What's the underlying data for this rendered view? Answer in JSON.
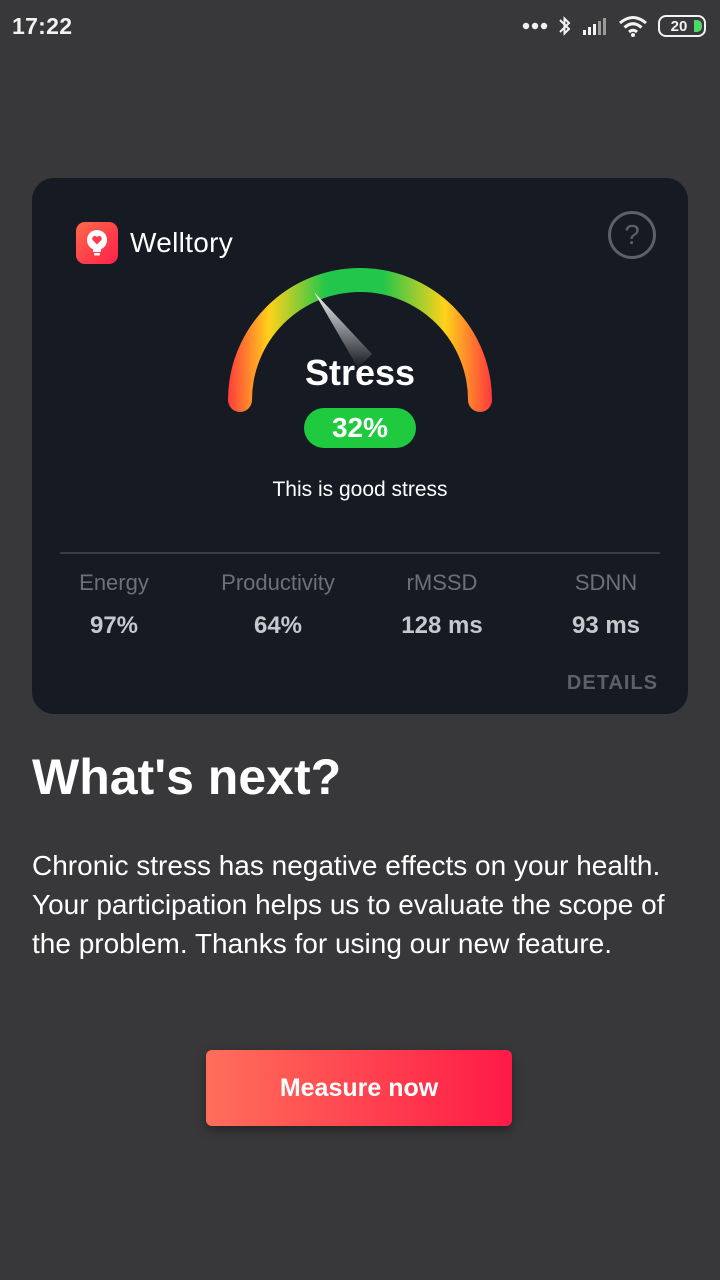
{
  "status_bar": {
    "time": "17:22",
    "battery": "20",
    "icons": [
      "dots-icon",
      "bluetooth-icon",
      "signal-icon",
      "wifi-icon",
      "battery-icon"
    ]
  },
  "card": {
    "brand": "Welltory",
    "help_symbol": "?",
    "gauge": {
      "title": "Stress",
      "value_text": "32%",
      "value": 32,
      "note": "This is good stress",
      "colors": [
        "#ff1744",
        "#ffd21a",
        "#22c64a"
      ]
    },
    "metrics": [
      {
        "label": "Energy",
        "value": "97%"
      },
      {
        "label": "Productivity",
        "value": "64%"
      },
      {
        "label": "rMSSD",
        "value": "128 ms"
      },
      {
        "label": "SDNN",
        "value": "93 ms"
      }
    ],
    "details_label": "DETAILS"
  },
  "next": {
    "title": "What's next?",
    "body": "Chronic stress has negative effects on your health. Your participation helps us to evaluate the scope of the problem. Thanks for using our new feature.",
    "button": "Measure now"
  },
  "colors": {
    "background": "#38383a",
    "card": "#161a22",
    "badge": "#1fca3e",
    "accent_start": "#ff6f5a",
    "accent_end": "#ff1a46"
  }
}
